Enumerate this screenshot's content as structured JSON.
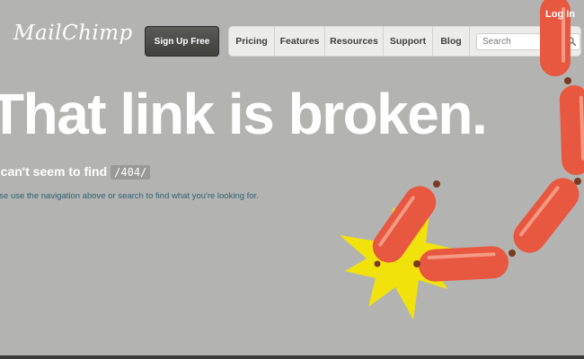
{
  "header": {
    "logo_text": "MailChimp",
    "signup_label": "Sign Up Free",
    "login_label": "Log In",
    "nav": [
      {
        "label": "Pricing"
      },
      {
        "label": "Features"
      },
      {
        "label": "Resources"
      },
      {
        "label": "Support"
      },
      {
        "label": "Blog"
      }
    ],
    "search": {
      "placeholder": "Search",
      "icon": "magnifier-icon"
    }
  },
  "main": {
    "headline": "That link is broken.",
    "subhead": "e can't seem to find",
    "path_code": "/404/",
    "help_text": "ase use the navigation above or search to find what you're looking for."
  },
  "illustration": {
    "subject": "sausage-links-burst",
    "colors": {
      "sausage": "#e8573f",
      "burst": "#f2e20c",
      "knot": "#7a3a22",
      "background": "#b3b3b2"
    }
  }
}
